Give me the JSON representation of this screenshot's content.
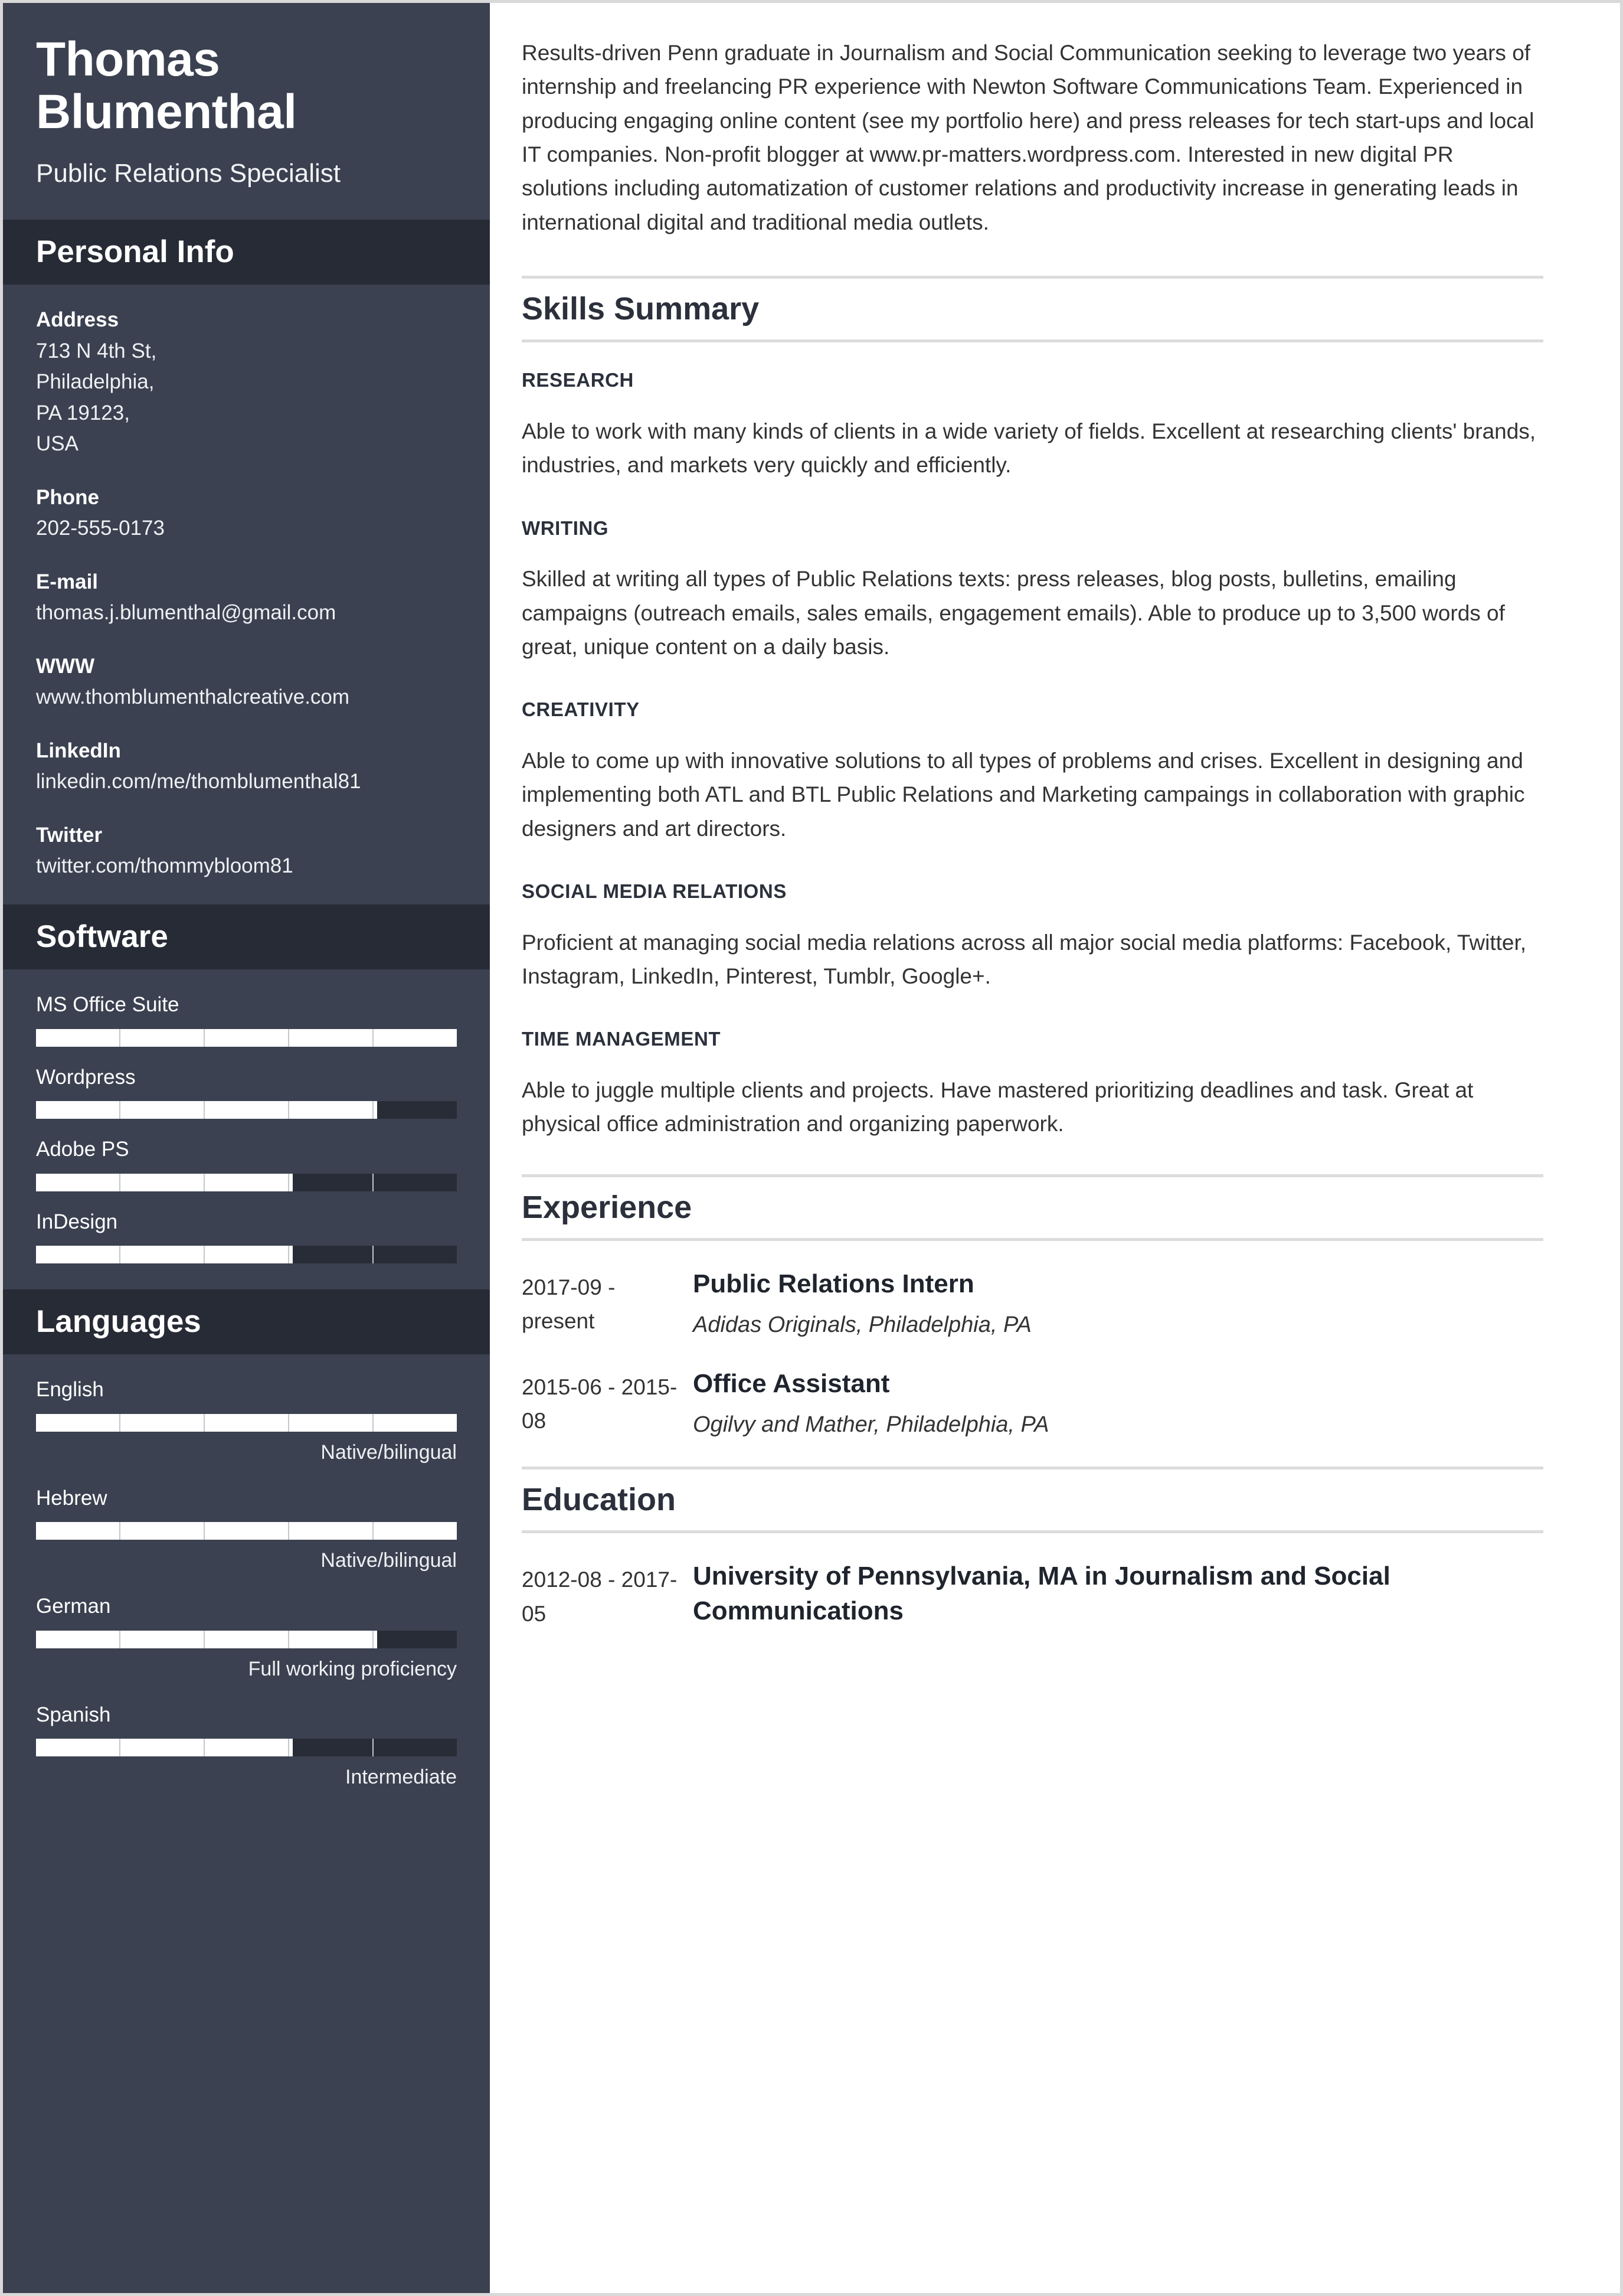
{
  "theme": {
    "sidebar_bg": "#3b4150",
    "sidebar_band_bg": "#262b35",
    "bar_track": "#272c36",
    "bar_fill": "#ffffff",
    "rule_color": "#dcdcdc",
    "heading_color": "#2b303b",
    "body_text": "#333333"
  },
  "sidebar": {
    "name": "Thomas Blumenthal",
    "job_title": "Public Relations Specialist",
    "personal_info": {
      "heading": "Personal Info",
      "items": [
        {
          "label": "Address",
          "value": "713 N 4th St,\nPhiladelphia,\nPA 19123,\nUSA"
        },
        {
          "label": "Phone",
          "value": "202-555-0173"
        },
        {
          "label": "E-mail",
          "value": "thomas.j.blumenthal@gmail.com"
        },
        {
          "label": "WWW",
          "value": "www.thomblumenthalcreative.com"
        },
        {
          "label": "LinkedIn",
          "value": "linkedin.com/me/thomblumenthal81"
        },
        {
          "label": "Twitter",
          "value": "twitter.com/thommybloom81"
        }
      ]
    },
    "software": {
      "heading": "Software",
      "items": [
        {
          "name": "MS Office Suite",
          "percent": 100
        },
        {
          "name": "Wordpress",
          "percent": 81
        },
        {
          "name": "Adobe PS",
          "percent": 61
        },
        {
          "name": "InDesign",
          "percent": 61
        }
      ]
    },
    "languages": {
      "heading": "Languages",
      "items": [
        {
          "name": "English",
          "percent": 100,
          "level": "Native/bilingual"
        },
        {
          "name": "Hebrew",
          "percent": 100,
          "level": "Native/bilingual"
        },
        {
          "name": "German",
          "percent": 81,
          "level": "Full working proficiency"
        },
        {
          "name": "Spanish",
          "percent": 61,
          "level": "Intermediate"
        }
      ]
    }
  },
  "main": {
    "summary": "Results-driven Penn graduate in Journalism and Social Communication seeking to leverage two years of internship and freelancing PR experience with Newton Software Communications Team. Experienced in producing engaging online content (see my portfolio here) and press releases for tech start-ups and local IT companies. Non-profit blogger at www.pr-matters.wordpress.com. Interested in new digital PR solutions including automatization of customer relations and productivity increase in generating leads in international digital and traditional media outlets.",
    "skills_summary": {
      "heading": "Skills Summary",
      "items": [
        {
          "title": "RESEARCH",
          "text": "Able to work with many kinds of clients in a wide variety of fields. Excellent at researching clients' brands, industries, and markets very quickly and efficiently."
        },
        {
          "title": "WRITING",
          "text": "Skilled at writing all types of Public Relations texts: press releases, blog posts, bulletins, emailing campaigns (outreach emails, sales emails, engagement emails). Able to produce up to 3,500 words of great, unique content on a daily basis."
        },
        {
          "title": "CREATIVITY",
          "text": "Able to come up with innovative solutions to all types of problems and crises. Excellent in designing and implementing both ATL and BTL Public Relations and Marketing campaings in collaboration with graphic designers and art directors."
        },
        {
          "title": "SOCIAL MEDIA RELATIONS",
          "text": "Proficient at managing social media relations across all major social media platforms: Facebook, Twitter, Instagram, LinkedIn, Pinterest, Tumblr, Google+."
        },
        {
          "title": "TIME MANAGEMENT",
          "text": "Able to juggle multiple clients and projects. Have mastered prioritizing deadlines and task. Great at physical office administration and organizing paperwork."
        }
      ]
    },
    "experience": {
      "heading": "Experience",
      "entries": [
        {
          "date": "2017-09 - present",
          "title": "Public Relations Intern",
          "subtitle": "Adidas Originals, Philadelphia, PA"
        },
        {
          "date": "2015-06 - 2015-08",
          "title": "Office Assistant",
          "subtitle": "Ogilvy and Mather, Philadelphia, PA"
        }
      ]
    },
    "education": {
      "heading": "Education",
      "entries": [
        {
          "date": "2012-08 - 2017-05",
          "title": "University of Pennsylvania, MA in Journalism and Social Communications",
          "subtitle": ""
        }
      ]
    }
  }
}
